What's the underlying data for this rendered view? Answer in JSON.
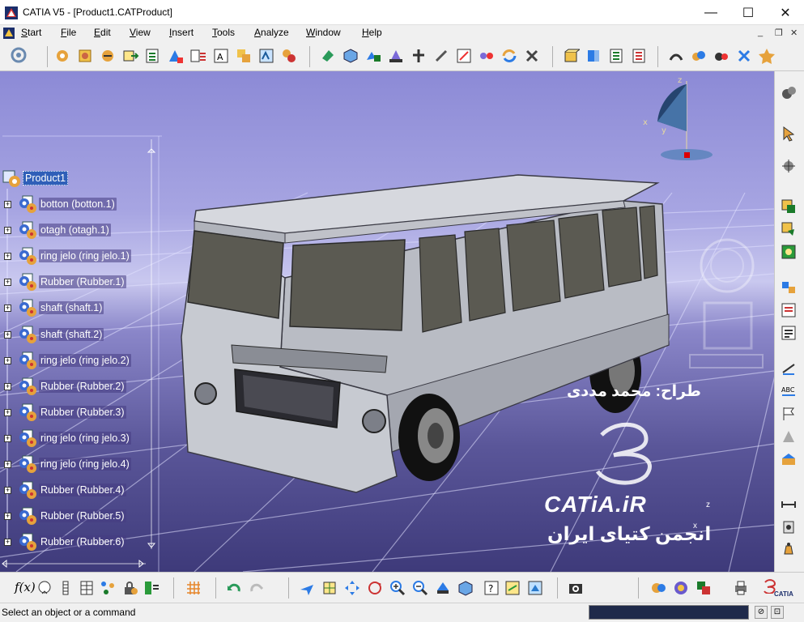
{
  "window": {
    "title": "CATIA V5 - [Product1.CATProduct]",
    "minimize": "—",
    "maximize": "☐",
    "close": "✕",
    "mdi_minimize": "_",
    "mdi_restore": "❐",
    "mdi_close": "✕"
  },
  "menu": {
    "items": [
      {
        "label": "Start",
        "underline": "S"
      },
      {
        "label": "File",
        "underline": "F"
      },
      {
        "label": "Edit",
        "underline": "E"
      },
      {
        "label": "View",
        "underline": "V"
      },
      {
        "label": "Insert",
        "underline": "I"
      },
      {
        "label": "Tools",
        "underline": "T"
      },
      {
        "label": "Analyze",
        "underline": "A"
      },
      {
        "label": "Window",
        "underline": "W"
      },
      {
        "label": "Help",
        "underline": "H"
      }
    ]
  },
  "tree": {
    "root": "Product1",
    "nodes": [
      {
        "label": "botton (botton.1)"
      },
      {
        "label": "otagh (otagh.1)"
      },
      {
        "label": "ring jelo (ring jelo.1)"
      },
      {
        "label": "Rubber (Rubber.1)"
      },
      {
        "label": "shaft (shaft.1)"
      },
      {
        "label": "shaft (shaft.2)"
      },
      {
        "label": "ring jelo (ring jelo.2)"
      },
      {
        "label": "Rubber (Rubber.2)"
      },
      {
        "label": "Rubber (Rubber.3)"
      },
      {
        "label": "ring jelo (ring jelo.3)"
      },
      {
        "label": "ring jelo (ring jelo.4)"
      },
      {
        "label": "Rubber (Rubber.4)"
      },
      {
        "label": "Rubber (Rubber.5)"
      },
      {
        "label": "Rubber (Rubber.6)"
      }
    ]
  },
  "compass": {
    "x_label": "x",
    "y_label": "y",
    "z_label": "z"
  },
  "watermark": {
    "designer_line": "طراح: محمد مددی",
    "site": "CATiA.iR",
    "society": "انجمن کتیای ایران",
    "axis_z": "z",
    "axis_x": "x"
  },
  "status": {
    "text": "Select an object or a command"
  },
  "bottom": {
    "fx_label": "f(x)",
    "catia_logo": "CATIA"
  },
  "colors": {
    "accent": "#2f5fb8",
    "viewport_top": "#8c8ad6",
    "viewport_bottom": "#3e3a7a"
  }
}
